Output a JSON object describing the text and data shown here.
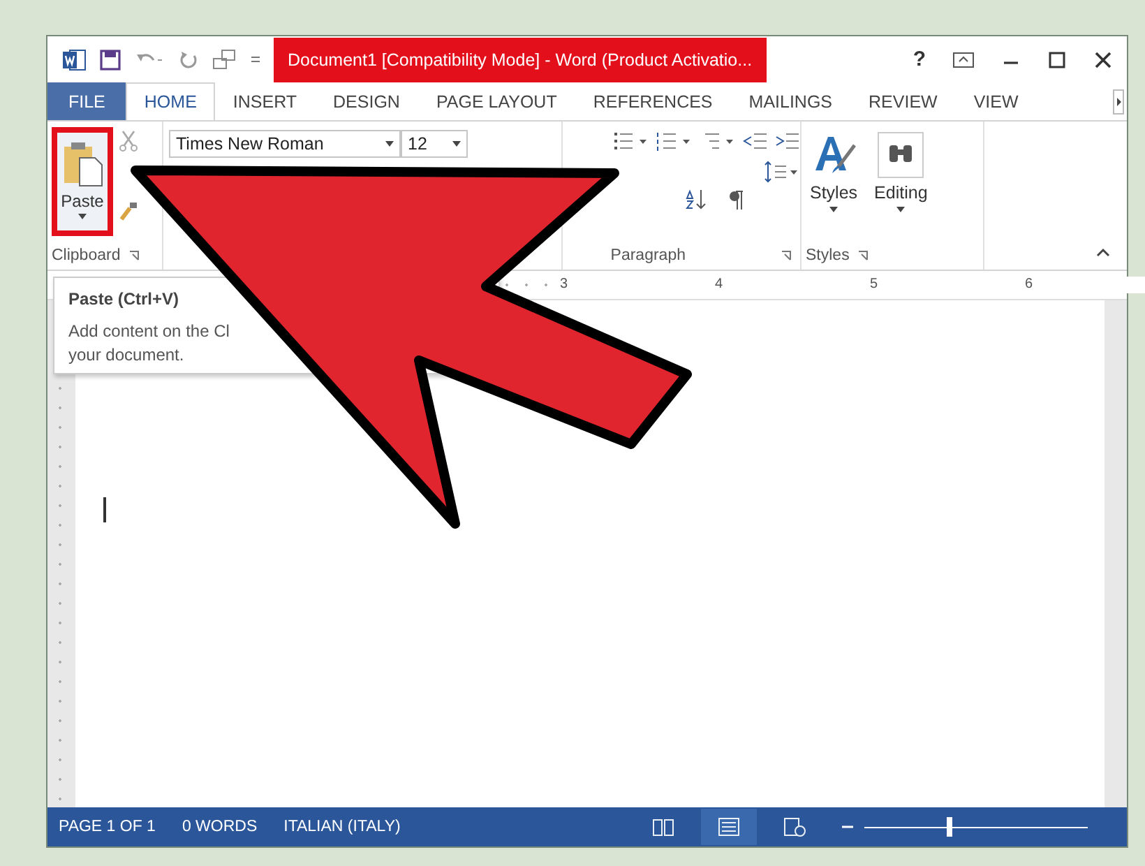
{
  "window": {
    "title": "Document1 [Compatibility Mode] - Word (Product Activatio...",
    "title_highlighted": true,
    "help": "?"
  },
  "tabs": [
    {
      "label": "FILE",
      "kind": "file",
      "selected": false
    },
    {
      "label": "HOME",
      "kind": "tab",
      "selected": true
    },
    {
      "label": "INSERT",
      "kind": "tab",
      "selected": false
    },
    {
      "label": "DESIGN",
      "kind": "tab",
      "selected": false
    },
    {
      "label": "PAGE LAYOUT",
      "kind": "tab",
      "selected": false
    },
    {
      "label": "REFERENCES",
      "kind": "tab",
      "selected": false
    },
    {
      "label": "MAILINGS",
      "kind": "tab",
      "selected": false
    },
    {
      "label": "REVIEW",
      "kind": "tab",
      "selected": false
    },
    {
      "label": "VIEW",
      "kind": "tab",
      "selected": false
    }
  ],
  "ribbon": {
    "paste": {
      "label": "Paste",
      "highlighted": true
    },
    "font": "Times New Roman",
    "size": "12",
    "styles": "Styles",
    "editing": "Editing",
    "groups": [
      "Clipboard",
      "Paragraph",
      "Styles"
    ]
  },
  "tooltip": {
    "title": "Paste (Ctrl+V)",
    "lines": [
      "Add content on the Cl",
      "your document."
    ]
  },
  "ruler": [
    "3",
    "4",
    "5",
    "6"
  ],
  "status_bar": {
    "items": [
      "PAGE 1 OF 1",
      "0 WORDS",
      "ITALIAN (ITALY)"
    ],
    "zoom": {
      "level": 0.37
    }
  }
}
